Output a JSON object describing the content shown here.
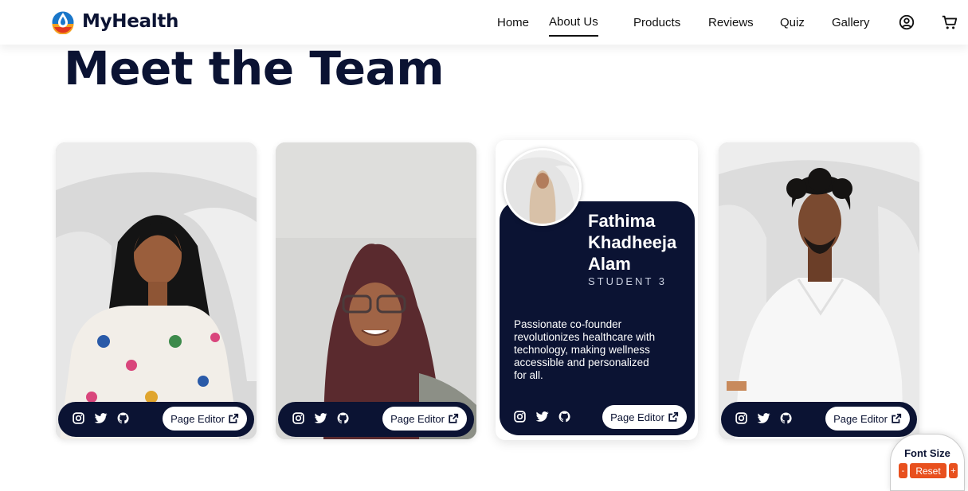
{
  "brand": {
    "name": "MyHealth"
  },
  "nav": {
    "links": [
      "Home",
      "About Us",
      "Products",
      "Reviews",
      "Quiz",
      "Gallery"
    ],
    "active": "About Us"
  },
  "page": {
    "heading": "Meet the Team"
  },
  "team": {
    "active_member": {
      "name": "Fathima Khadheeja Alam",
      "role": "STUDENT 3",
      "bio": "Passionate co-founder revolutionizes healthcare with technology, making wellness accessible and personalized for all."
    },
    "page_editor_label": "Page Editor",
    "socials": [
      "instagram-icon",
      "twitter-icon",
      "github-icon"
    ]
  },
  "font_widget": {
    "title": "Font Size",
    "decrease": "-",
    "reset": "Reset",
    "increase": "+"
  },
  "colors": {
    "navy": "#0b1333",
    "accent": "#e8501e"
  }
}
